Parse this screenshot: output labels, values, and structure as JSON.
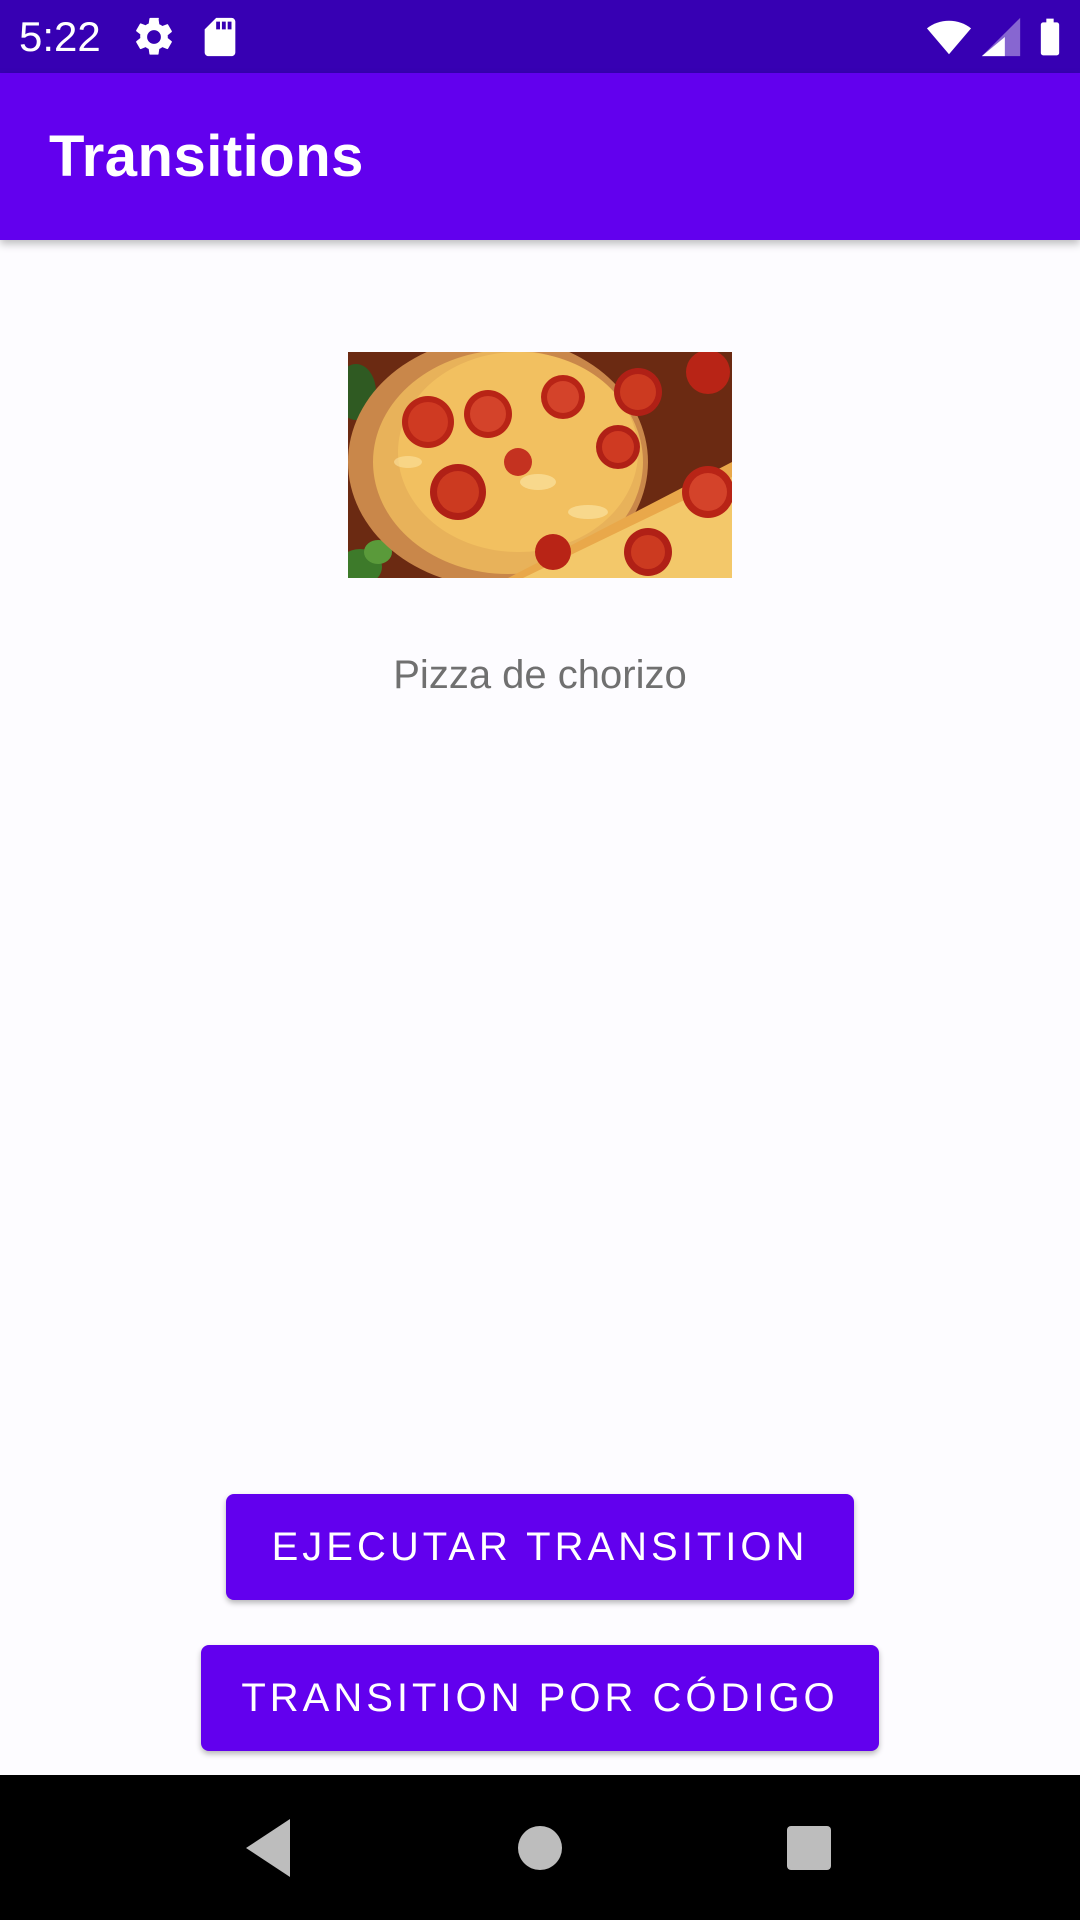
{
  "status_bar": {
    "time": "5:22",
    "icons": [
      "settings-icon",
      "sd-card-icon",
      "wifi-icon",
      "cell-signal-icon",
      "battery-icon"
    ],
    "background": "#3700b3"
  },
  "app_bar": {
    "title": "Transitions",
    "background": "#6200ee"
  },
  "content": {
    "image_icon": "pizza-image",
    "label": "Pizza de chorizo"
  },
  "buttons": {
    "run_label": "EJECUTAR TRANSITION",
    "code_label": "TRANSITION POR CÓDIGO",
    "color": "#6200ee"
  },
  "nav_bar": {
    "icons": [
      "back-icon",
      "home-icon",
      "recents-icon"
    ]
  }
}
